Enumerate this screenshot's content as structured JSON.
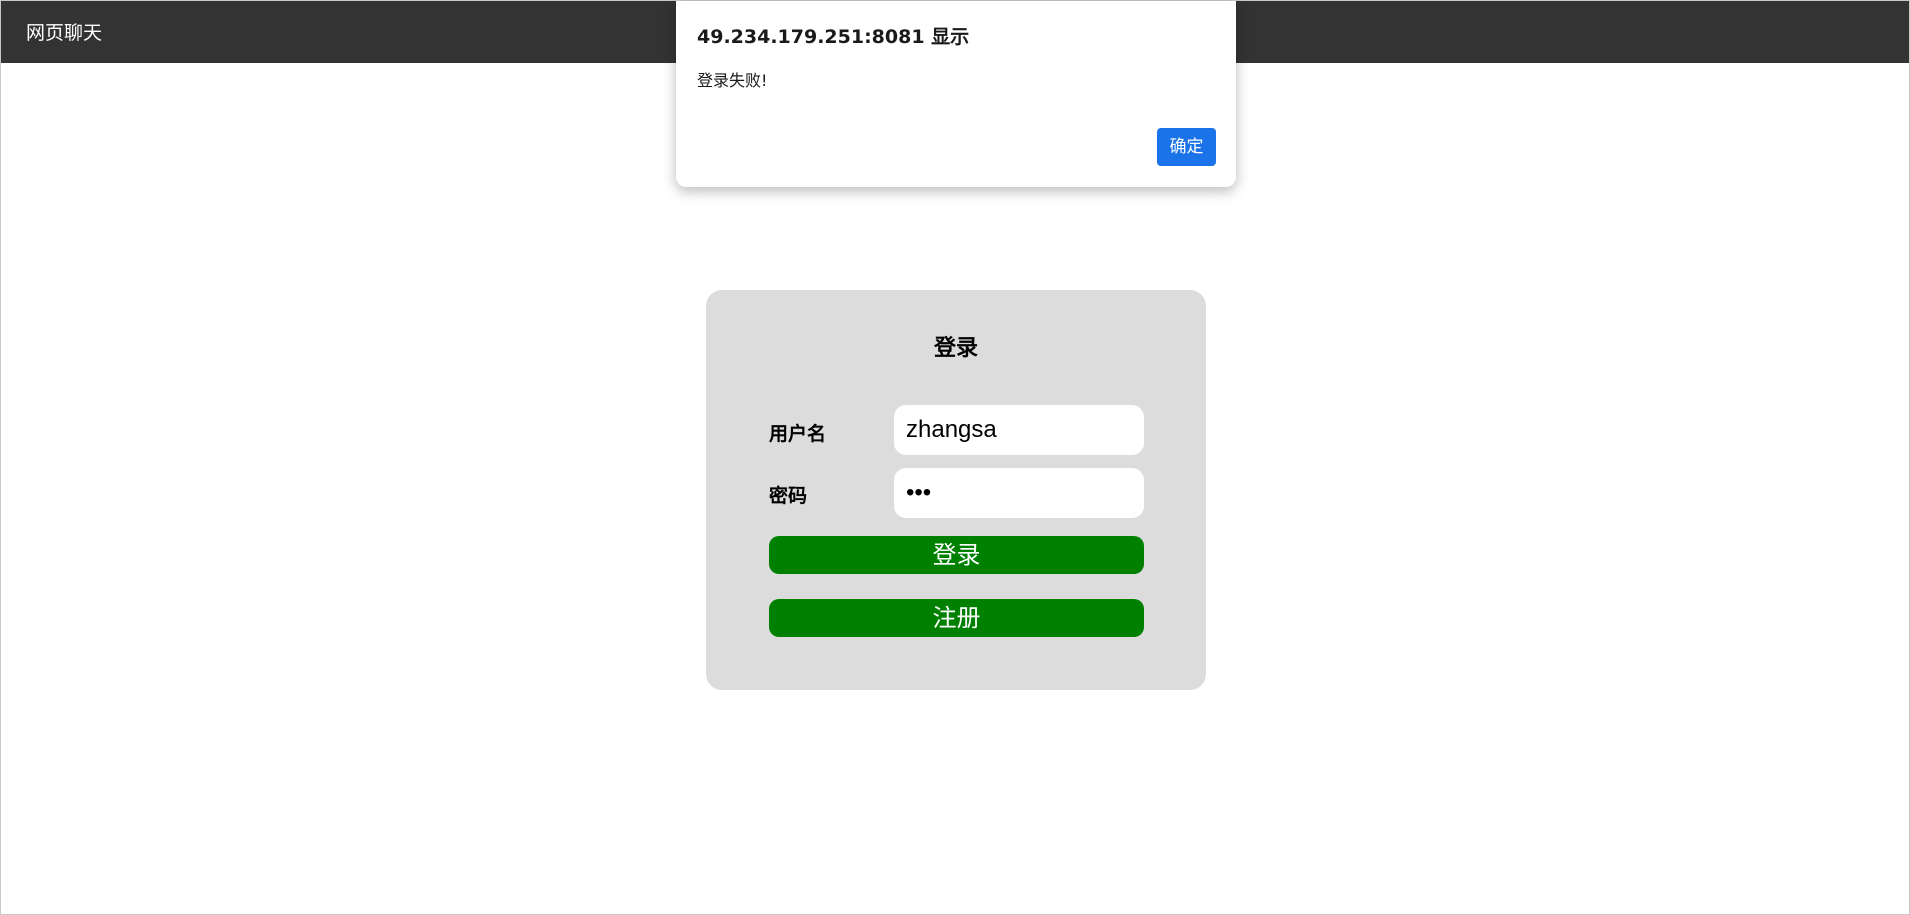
{
  "navbar": {
    "title": "网页聊天"
  },
  "login": {
    "title": "登录",
    "username_label": "用户名",
    "username_value": "zhangsa",
    "password_label": "密码",
    "password_value": "123",
    "login_button": "登录",
    "register_button": "注册"
  },
  "alert": {
    "origin": "49.234.179.251:8081 显示",
    "message": "登录失败!",
    "ok_button": "确定"
  },
  "colors": {
    "navbar_bg": "#333333",
    "card_bg": "#dcdcdc",
    "button_green": "#008000",
    "alert_ok_blue": "#1a73e8"
  }
}
